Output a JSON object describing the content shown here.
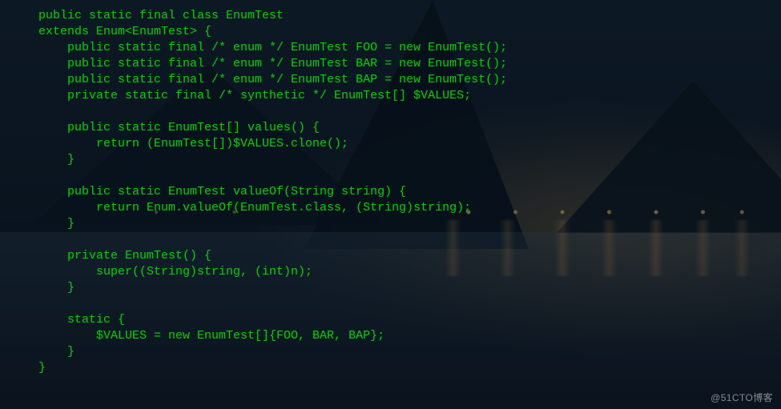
{
  "code": {
    "lines": [
      "public static final class EnumTest",
      "extends Enum<EnumTest> {",
      "    public static final /* enum */ EnumTest FOO = new EnumTest();",
      "    public static final /* enum */ EnumTest BAR = new EnumTest();",
      "    public static final /* enum */ EnumTest BAP = new EnumTest();",
      "    private static final /* synthetic */ EnumTest[] $VALUES;",
      "",
      "    public static EnumTest[] values() {",
      "        return (EnumTest[])$VALUES.clone();",
      "    }",
      "",
      "    public static EnumTest valueOf(String string) {",
      "        return Enum.valueOf(EnumTest.class, (String)string);",
      "    }",
      "",
      "    private EnumTest() {",
      "        super((String)string, (int)n);",
      "    }",
      "",
      "    static {",
      "        $VALUES = new EnumTest[]{FOO, BAR, BAP};",
      "    }",
      "}"
    ]
  },
  "watermark": "@51CTO博客",
  "colors": {
    "code_text": "#13c513",
    "bg_top": "#162735",
    "bg_bottom": "#0b1522"
  }
}
